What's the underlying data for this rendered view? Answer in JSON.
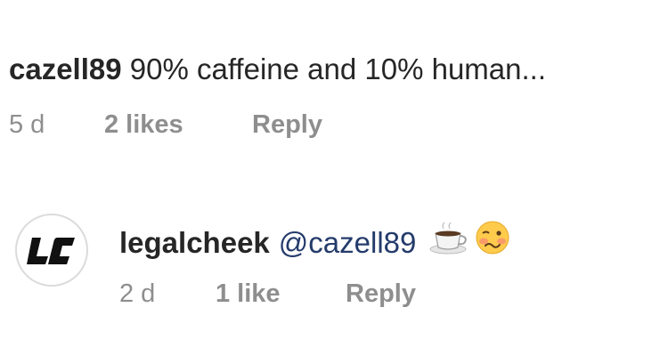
{
  "comments": [
    {
      "username": "cazell89",
      "text": "90% caffeine and 10% human...",
      "time": "5 d",
      "likes": "2 likes",
      "reply": "Reply"
    },
    {
      "username": "legalcheek",
      "mention": "@cazell89",
      "avatar_text": "LC",
      "emojis": [
        "coffee-cup-icon",
        "woozy-face-icon"
      ],
      "time": "2 d",
      "likes": "1 like",
      "reply": "Reply"
    }
  ],
  "colors": {
    "text": "#262626",
    "meta": "#8e8e8e",
    "mention": "#243b6b",
    "avatar_border": "#dbdbdb"
  }
}
